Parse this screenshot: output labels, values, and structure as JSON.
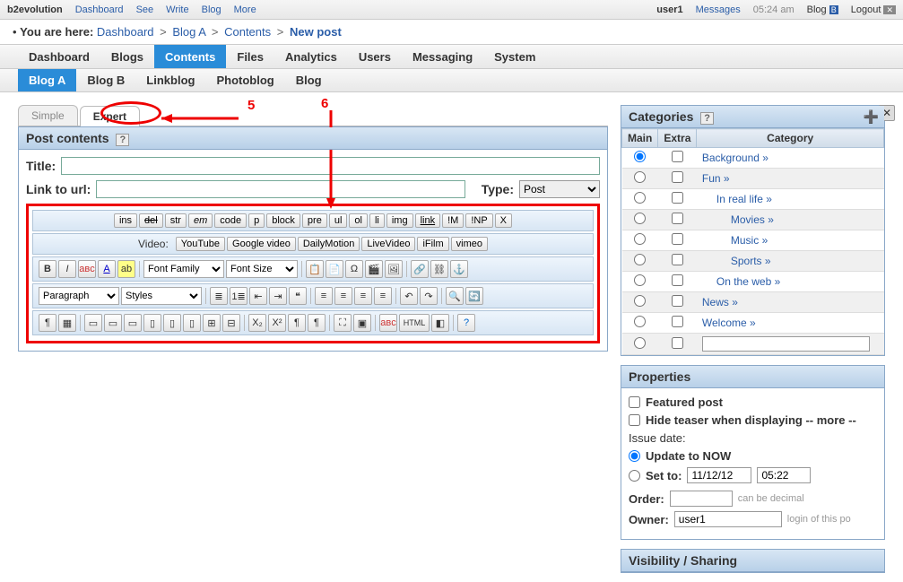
{
  "topbar": {
    "brand": "b2evolution",
    "items": [
      "Dashboard",
      "See",
      "Write",
      "Blog",
      "More"
    ],
    "user": "user1",
    "messages": "Messages",
    "time": "05:24 am",
    "blog_link": "Blog",
    "logout": "Logout"
  },
  "breadcrumb": {
    "prefix": "You are here:",
    "items": [
      "Dashboard",
      "Blog A",
      "Contents"
    ],
    "current": "New post"
  },
  "mainnav": [
    "Dashboard",
    "Blogs",
    "Contents",
    "Files",
    "Analytics",
    "Users",
    "Messaging",
    "System"
  ],
  "mainnav_active": 2,
  "subnav": [
    "Blog A",
    "Blog B",
    "Linkblog",
    "Photoblog",
    "Blog"
  ],
  "subnav_active": 0,
  "tabs": {
    "simple": "Simple",
    "expert": "Expert"
  },
  "annotations": {
    "n5": "5",
    "n6": "6"
  },
  "post": {
    "panel_title": "Post contents",
    "title_label": "Title:",
    "title_value": "",
    "link_label": "Link to url:",
    "link_value": "",
    "type_label": "Type:",
    "type_value": "Post"
  },
  "toolbar1": [
    "ins",
    "del",
    "str",
    "em",
    "code",
    "p",
    "block",
    "pre",
    "ul",
    "ol",
    "li",
    "img",
    "link",
    "!M",
    "!NP",
    "X"
  ],
  "video_row": {
    "label": "Video:",
    "items": [
      "YouTube",
      "Google video",
      "DailyMotion",
      "LiveVideo",
      "iFilm",
      "vimeo"
    ]
  },
  "wysiwyg": {
    "font_family": "Font Family",
    "font_size": "Font Size",
    "paragraph": "Paragraph",
    "styles": "Styles",
    "html": "HTML"
  },
  "categories": {
    "panel_title": "Categories",
    "cols": [
      "Main",
      "Extra",
      "Category"
    ],
    "rows": [
      {
        "name": "Background",
        "indent": 0,
        "main": true
      },
      {
        "name": "Fun",
        "indent": 0
      },
      {
        "name": "In real life",
        "indent": 1
      },
      {
        "name": "Movies",
        "indent": 2
      },
      {
        "name": "Music",
        "indent": 2
      },
      {
        "name": "Sports",
        "indent": 2
      },
      {
        "name": "On the web",
        "indent": 1
      },
      {
        "name": "News",
        "indent": 0
      },
      {
        "name": "Welcome",
        "indent": 0
      }
    ]
  },
  "properties": {
    "panel_title": "Properties",
    "featured": "Featured post",
    "hide_teaser": "Hide teaser when displaying -- more --",
    "issue_date": "Issue date:",
    "update_now": "Update to NOW",
    "set_to": "Set to:",
    "date": "11/12/12",
    "time": "05:22",
    "order_label": "Order:",
    "order_hint": "can be decimal",
    "owner_label": "Owner:",
    "owner_value": "user1",
    "owner_hint": "login of this po"
  },
  "visibility": {
    "panel_title": "Visibility / Sharing"
  }
}
